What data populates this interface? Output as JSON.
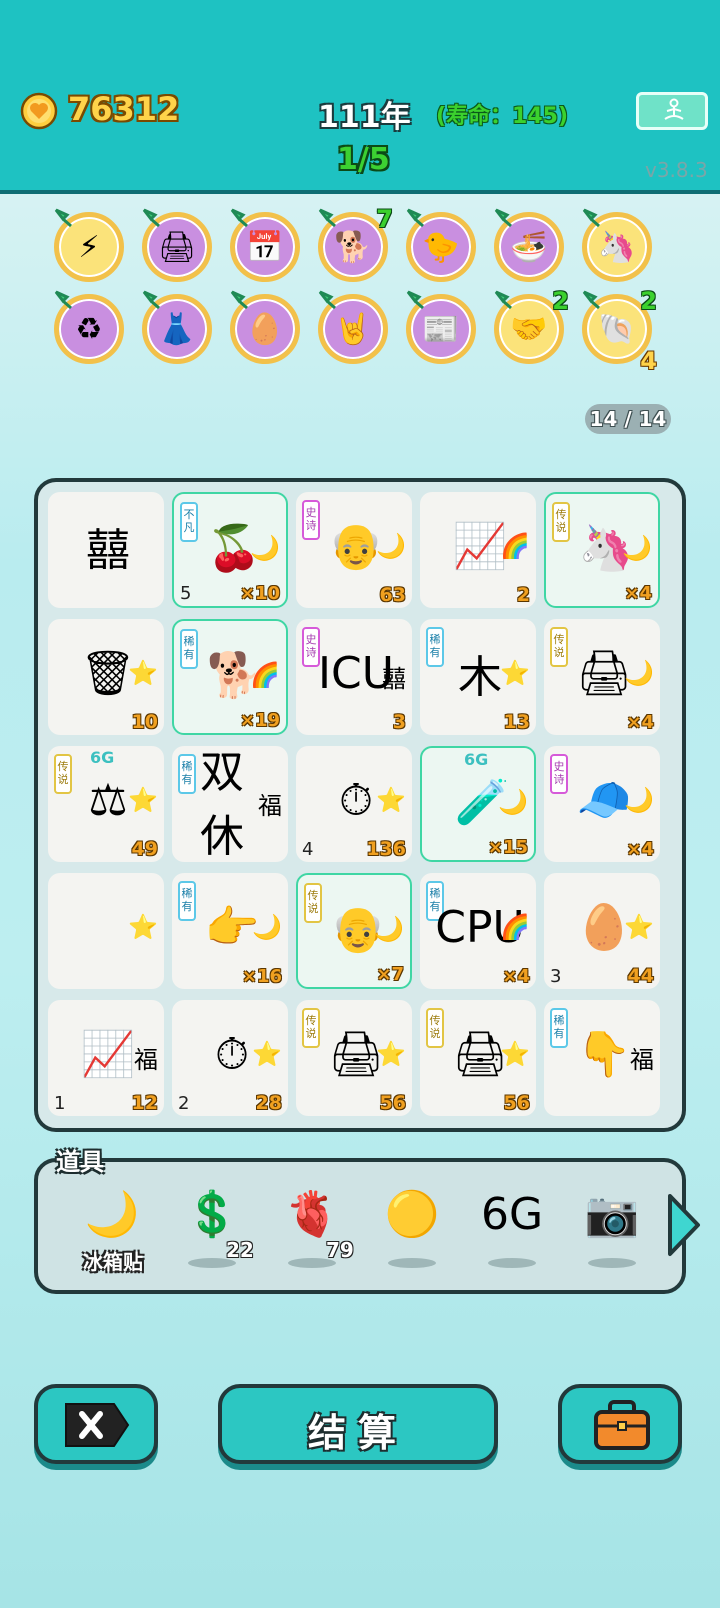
{
  "header": {
    "coins": "76312",
    "year": "111年",
    "lifespan": "(寿命：145)",
    "round": "1/5",
    "version": "v3.8.3"
  },
  "badges": [
    {
      "icon": "lightning-icon",
      "glyph": "⚡",
      "bg": "#fbe37a"
    },
    {
      "icon": "printer-icon",
      "glyph": "🖨",
      "bg": "#c98fe0"
    },
    {
      "icon": "calendar-icon",
      "glyph": "📅",
      "bg": "#c98fe0"
    },
    {
      "icon": "husky-dog-icon",
      "glyph": "🐕",
      "bg": "#c98fe0",
      "count": "7"
    },
    {
      "icon": "chicken-icon",
      "glyph": "🐤",
      "bg": "#c98fe0"
    },
    {
      "icon": "bowls-icon",
      "glyph": "🍜",
      "bg": "#c98fe0"
    },
    {
      "icon": "unicorn-icon",
      "glyph": "🦄",
      "bg": "#fbe37a"
    },
    {
      "icon": "recycle-icon",
      "glyph": "♻",
      "bg": "#c98fe0"
    },
    {
      "icon": "skirt-icon",
      "glyph": "👗",
      "bg": "#c98fe0"
    },
    {
      "icon": "egg-icon",
      "glyph": "🥚",
      "bg": "#c98fe0"
    },
    {
      "icon": "rock-hand-icon",
      "glyph": "🤘",
      "bg": "#c98fe0"
    },
    {
      "icon": "time-magazine-icon",
      "glyph": "📰",
      "bg": "#c98fe0"
    },
    {
      "icon": "handshake-icon",
      "glyph": "🤝",
      "bg": "#fbe37a",
      "count": "2"
    },
    {
      "icon": "shell-icon",
      "glyph": "🐚",
      "bg": "#fbe37a",
      "count": "2",
      "count_bottom": "4"
    }
  ],
  "board_counter": "14 / 14",
  "grid": [
    {
      "icon": "happy-sticker-icon",
      "glyph": "囍",
      "deco": "",
      "tag": "",
      "left": "",
      "right": "",
      "mult": "",
      "hl": false,
      "sixg": ""
    },
    {
      "icon": "berries-icon",
      "glyph": "🍒",
      "deco": "🌙",
      "tag": "不凡",
      "tagtype": "rare2",
      "left": "5",
      "right": "",
      "mult": "×10",
      "hl": true,
      "sixg": ""
    },
    {
      "icon": "old-man-icon",
      "glyph": "👴",
      "deco": "🌙",
      "tag": "史诗",
      "tagtype": "epic",
      "left": "",
      "right": "63",
      "mult": "",
      "hl": false,
      "sixg": ""
    },
    {
      "icon": "chart-up-icon",
      "glyph": "📈",
      "deco": "🌈",
      "tag": "",
      "left": "",
      "right": "2",
      "mult": "",
      "hl": false,
      "sixg": ""
    },
    {
      "icon": "unicorn-icon",
      "glyph": "🦄",
      "deco": "🌙",
      "tag": "传说",
      "tagtype": "legend",
      "left": "",
      "right": "",
      "mult": "×4",
      "hl": true,
      "sixg": ""
    },
    {
      "icon": "trash-bag-icon",
      "glyph": "🗑",
      "deco": "⭐",
      "tag": "",
      "left": "",
      "right": "10",
      "mult": "",
      "hl": false,
      "sixg": ""
    },
    {
      "icon": "husky-dog-icon",
      "glyph": "🐕",
      "deco": "🌈",
      "tag": "稀有",
      "tagtype": "rare2",
      "left": "",
      "right": "",
      "mult": "×19",
      "hl": true,
      "sixg": ""
    },
    {
      "icon": "icu-icon",
      "glyph": "ICU",
      "deco": "囍",
      "tag": "史诗",
      "tagtype": "epic",
      "left": "",
      "right": "3",
      "mult": "",
      "hl": false,
      "sixg": ""
    },
    {
      "icon": "wood-pentagon-icon",
      "glyph": "木",
      "deco": "⭐",
      "tag": "稀有",
      "tagtype": "rare2",
      "left": "",
      "right": "13",
      "mult": "",
      "hl": false,
      "sixg": ""
    },
    {
      "icon": "printer-icon",
      "glyph": "🖨",
      "deco": "🌙",
      "tag": "传说",
      "tagtype": "legend",
      "left": "",
      "right": "",
      "mult": "×4",
      "hl": false,
      "sixg": ""
    },
    {
      "icon": "scale-icon",
      "glyph": "⚖",
      "deco": "⭐",
      "tag": "传说",
      "tagtype": "legend",
      "left": "",
      "right": "49",
      "mult": "",
      "hl": false,
      "sixg": "6G"
    },
    {
      "icon": "double-rest-icon",
      "glyph": "双休",
      "deco": "福",
      "tag": "稀有",
      "tagtype": "rare2",
      "left": "",
      "right": "",
      "mult": "",
      "hl": false,
      "sixg": ""
    },
    {
      "icon": "stopwatch-icon",
      "glyph": "⏱",
      "deco": "⭐",
      "tag": "",
      "left": "4",
      "right": "136",
      "mult": "",
      "hl": false,
      "sixg": ""
    },
    {
      "icon": "glass-plus-icon",
      "glyph": "🧪",
      "deco": "🌙",
      "tag": "",
      "left": "",
      "right": "",
      "mult": "×15",
      "hl": true,
      "sixg": "6G"
    },
    {
      "icon": "green-hat-man-icon",
      "glyph": "🧢",
      "deco": "🌙",
      "tag": "史诗",
      "tagtype": "epic",
      "left": "",
      "right": "",
      "mult": "×4",
      "hl": false,
      "sixg": ""
    },
    {
      "icon": "star-icon",
      "glyph": "",
      "deco": "⭐",
      "tag": "",
      "left": "",
      "right": "",
      "mult": "",
      "hl": false,
      "sixg": ""
    },
    {
      "icon": "pointing-hand-icon",
      "glyph": "👉",
      "deco": "🌙",
      "tag": "稀有",
      "tagtype": "rare2",
      "left": "",
      "right": "",
      "mult": "×16",
      "hl": false,
      "sixg": ""
    },
    {
      "icon": "old-man-glasses-icon",
      "glyph": "👴",
      "deco": "🌙",
      "tag": "传说",
      "tagtype": "legend",
      "left": "",
      "right": "",
      "mult": "×7",
      "hl": true,
      "sixg": ""
    },
    {
      "icon": "cpu-icon",
      "glyph": "CPU",
      "deco": "🌈",
      "tag": "稀有",
      "tagtype": "rare2",
      "left": "",
      "right": "",
      "mult": "×4",
      "hl": false,
      "sixg": ""
    },
    {
      "icon": "egg-icon",
      "glyph": "🥚",
      "deco": "⭐",
      "tag": "",
      "left": "3",
      "right": "44",
      "mult": "",
      "hl": false,
      "sixg": ""
    },
    {
      "icon": "trend-icon",
      "glyph": "📈",
      "deco": "福",
      "tag": "",
      "left": "1",
      "right": "12",
      "mult": "",
      "hl": false,
      "sixg": ""
    },
    {
      "icon": "stopwatch-icon",
      "glyph": "⏱",
      "deco": "⭐",
      "tag": "",
      "left": "2",
      "right": "28",
      "mult": "",
      "hl": false,
      "sixg": ""
    },
    {
      "icon": "printer-icon",
      "glyph": "🖨",
      "deco": "⭐",
      "tag": "传说",
      "tagtype": "legend",
      "left": "",
      "right": "56",
      "mult": "",
      "hl": false,
      "sixg": ""
    },
    {
      "icon": "printer-icon",
      "glyph": "🖨",
      "deco": "⭐",
      "tag": "传说",
      "tagtype": "legend",
      "left": "",
      "right": "56",
      "mult": "",
      "hl": false,
      "sixg": ""
    },
    {
      "icon": "pointing-hand-icon",
      "glyph": "👇",
      "deco": "福",
      "tag": "稀有",
      "tagtype": "rare2",
      "left": "",
      "right": "",
      "mult": "",
      "hl": false,
      "sixg": ""
    }
  ],
  "items": {
    "title": "道具",
    "list": [
      {
        "icon": "moon-sticker-icon",
        "glyph": "🌙",
        "label": "冰箱贴",
        "qty": ""
      },
      {
        "icon": "dollar-coin-icon",
        "glyph": "💲",
        "label": "",
        "qty": "22"
      },
      {
        "icon": "liver-icon",
        "glyph": "🫀",
        "label": "",
        "qty": "79"
      },
      {
        "icon": "golden-ball-icon",
        "glyph": "🟡",
        "label": "",
        "qty": ""
      },
      {
        "icon": "6g-icon",
        "glyph": "6G",
        "label": "",
        "qty": ""
      },
      {
        "icon": "camera-icon",
        "glyph": "📷",
        "label": "",
        "qty": ""
      }
    ]
  },
  "buttons": {
    "settle": "结算"
  }
}
